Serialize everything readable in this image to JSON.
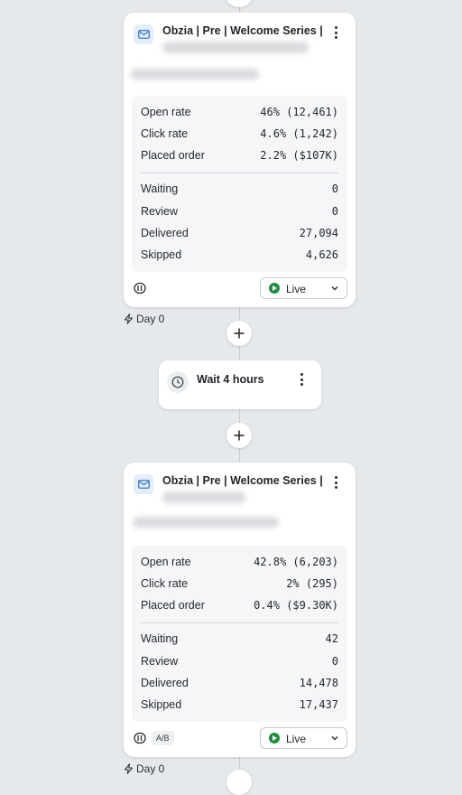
{
  "cards": [
    {
      "title": "Obzia | Pre | Welcome Series |",
      "metrics": [
        {
          "label": "Open rate",
          "value": "46% (12,461)"
        },
        {
          "label": "Click rate",
          "value": "4.6% (1,242)"
        },
        {
          "label": "Placed order",
          "value": "2.2% ($107K)"
        }
      ],
      "counts": [
        {
          "label": "Waiting",
          "value": "0"
        },
        {
          "label": "Review",
          "value": "0"
        },
        {
          "label": "Delivered",
          "value": "27,094"
        },
        {
          "label": "Skipped",
          "value": "4,626"
        }
      ],
      "status": "Live",
      "trigger_label": "Day 0"
    },
    {
      "title": "Obzia | Pre | Welcome Series |",
      "metrics": [
        {
          "label": "Open rate",
          "value": "42.8% (6,203)"
        },
        {
          "label": "Click rate",
          "value": "2% (295)"
        },
        {
          "label": "Placed order",
          "value": "0.4% ($9.30K)"
        }
      ],
      "counts": [
        {
          "label": "Waiting",
          "value": "42"
        },
        {
          "label": "Review",
          "value": "0"
        },
        {
          "label": "Delivered",
          "value": "14,478"
        },
        {
          "label": "Skipped",
          "value": "17,437"
        }
      ],
      "badge": "A/B",
      "status": "Live",
      "trigger_label": "Day 0"
    }
  ],
  "wait_step": {
    "label": "Wait 4 hours"
  },
  "icons": {
    "email": "envelope-icon",
    "menu": "kebab-menu-icon",
    "add": "plus-icon",
    "clock": "clock-icon",
    "trigger": "lightning-icon",
    "smart_send": "smart-send-icon",
    "status": "play-circle-icon",
    "dropdown": "chevron-down-icon"
  },
  "colors": {
    "canvas": "#e6e9ec",
    "live_green": "#1a8f3c",
    "email_icon_bg": "#e2eefc",
    "email_icon": "#3b78c4"
  }
}
